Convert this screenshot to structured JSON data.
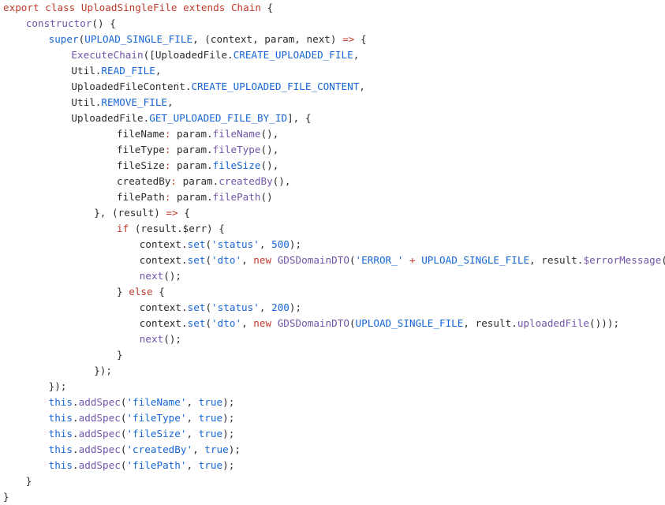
{
  "editor": {
    "language": "javascript",
    "file_title": "UploadSingleFile",
    "background_color": "#ffffff",
    "colors": {
      "keyword": "#c0392b",
      "function": "#7253a8",
      "constant": "#1565d8",
      "string": "#1565d8",
      "number": "#1565d8",
      "plain": "#2b2b2b",
      "property_colon": "#c0392b"
    }
  },
  "code": {
    "lines": [
      {
        "indent": 0,
        "tokens": [
          {
            "t": "export",
            "c": "kw"
          },
          {
            "t": " ",
            "c": "plain"
          },
          {
            "t": "class",
            "c": "kw"
          },
          {
            "t": " ",
            "c": "plain"
          },
          {
            "t": "UploadSingleFile",
            "c": "kw"
          },
          {
            "t": " ",
            "c": "plain"
          },
          {
            "t": "extends",
            "c": "kw"
          },
          {
            "t": " ",
            "c": "plain"
          },
          {
            "t": "Chain",
            "c": "kw"
          },
          {
            "t": " {",
            "c": "plain"
          }
        ]
      },
      {
        "indent": 1,
        "tokens": [
          {
            "t": "constructor",
            "c": "fn"
          },
          {
            "t": "() {",
            "c": "plain"
          }
        ]
      },
      {
        "indent": 2,
        "tokens": [
          {
            "t": "super",
            "c": "const"
          },
          {
            "t": "(",
            "c": "plain"
          },
          {
            "t": "UPLOAD_SINGLE_FILE",
            "c": "const"
          },
          {
            "t": ", (context, param, next) ",
            "c": "plain"
          },
          {
            "t": "=>",
            "c": "kw"
          },
          {
            "t": " {",
            "c": "plain"
          }
        ]
      },
      {
        "indent": 3,
        "tokens": [
          {
            "t": "ExecuteChain",
            "c": "fn"
          },
          {
            "t": "([UploadedFile.",
            "c": "plain"
          },
          {
            "t": "CREATE_UPLOADED_FILE",
            "c": "const"
          },
          {
            "t": ",",
            "c": "plain"
          }
        ]
      },
      {
        "indent": 3,
        "tokens": [
          {
            "t": "Util.",
            "c": "plain"
          },
          {
            "t": "READ_FILE",
            "c": "const"
          },
          {
            "t": ",",
            "c": "plain"
          }
        ]
      },
      {
        "indent": 3,
        "tokens": [
          {
            "t": "UploadedFileContent.",
            "c": "plain"
          },
          {
            "t": "CREATE_UPLOADED_FILE_CONTENT",
            "c": "const"
          },
          {
            "t": ",",
            "c": "plain"
          }
        ]
      },
      {
        "indent": 3,
        "tokens": [
          {
            "t": "Util.",
            "c": "plain"
          },
          {
            "t": "REMOVE_FILE",
            "c": "const"
          },
          {
            "t": ",",
            "c": "plain"
          }
        ]
      },
      {
        "indent": 3,
        "tokens": [
          {
            "t": "UploadedFile.",
            "c": "plain"
          },
          {
            "t": "GET_UPLOADED_FILE_BY_ID",
            "c": "const"
          },
          {
            "t": "], {",
            "c": "plain"
          }
        ]
      },
      {
        "indent": 5,
        "tokens": [
          {
            "t": "fileName",
            "c": "plain"
          },
          {
            "t": ":",
            "c": "colon"
          },
          {
            "t": " param.",
            "c": "plain"
          },
          {
            "t": "fileName",
            "c": "fn"
          },
          {
            "t": "(),",
            "c": "plain"
          }
        ]
      },
      {
        "indent": 5,
        "tokens": [
          {
            "t": "fileType",
            "c": "plain"
          },
          {
            "t": ":",
            "c": "colon"
          },
          {
            "t": " param.",
            "c": "plain"
          },
          {
            "t": "fileType",
            "c": "fn"
          },
          {
            "t": "(),",
            "c": "plain"
          }
        ]
      },
      {
        "indent": 5,
        "tokens": [
          {
            "t": "fileSize",
            "c": "plain"
          },
          {
            "t": ":",
            "c": "colon"
          },
          {
            "t": " param.",
            "c": "plain"
          },
          {
            "t": "fileSize",
            "c": "const"
          },
          {
            "t": "(),",
            "c": "plain"
          }
        ]
      },
      {
        "indent": 5,
        "tokens": [
          {
            "t": "createdBy",
            "c": "plain"
          },
          {
            "t": ":",
            "c": "colon"
          },
          {
            "t": " param.",
            "c": "plain"
          },
          {
            "t": "createdBy",
            "c": "fn"
          },
          {
            "t": "(),",
            "c": "plain"
          }
        ]
      },
      {
        "indent": 5,
        "tokens": [
          {
            "t": "filePath",
            "c": "plain"
          },
          {
            "t": ":",
            "c": "colon"
          },
          {
            "t": " param.",
            "c": "plain"
          },
          {
            "t": "filePath",
            "c": "fn"
          },
          {
            "t": "()",
            "c": "plain"
          }
        ]
      },
      {
        "indent": 4,
        "tokens": [
          {
            "t": "}, (result) ",
            "c": "plain"
          },
          {
            "t": "=>",
            "c": "kw"
          },
          {
            "t": " {",
            "c": "plain"
          }
        ]
      },
      {
        "indent": 5,
        "tokens": [
          {
            "t": "if",
            "c": "kw"
          },
          {
            "t": " (result.$err) {",
            "c": "plain"
          }
        ]
      },
      {
        "indent": 6,
        "tokens": [
          {
            "t": "context.",
            "c": "plain"
          },
          {
            "t": "set",
            "c": "const"
          },
          {
            "t": "(",
            "c": "plain"
          },
          {
            "t": "'status'",
            "c": "str"
          },
          {
            "t": ", ",
            "c": "plain"
          },
          {
            "t": "500",
            "c": "num"
          },
          {
            "t": ");",
            "c": "plain"
          }
        ]
      },
      {
        "indent": 6,
        "tokens": [
          {
            "t": "context.",
            "c": "plain"
          },
          {
            "t": "set",
            "c": "const"
          },
          {
            "t": "(",
            "c": "plain"
          },
          {
            "t": "'dto'",
            "c": "str"
          },
          {
            "t": ", ",
            "c": "plain"
          },
          {
            "t": "new",
            "c": "kw"
          },
          {
            "t": " ",
            "c": "plain"
          },
          {
            "t": "GDSDomainDTO",
            "c": "fn"
          },
          {
            "t": "(",
            "c": "plain"
          },
          {
            "t": "'ERROR_'",
            "c": "str"
          },
          {
            "t": " ",
            "c": "plain"
          },
          {
            "t": "+",
            "c": "kw"
          },
          {
            "t": " ",
            "c": "plain"
          },
          {
            "t": "UPLOAD_SINGLE_FILE",
            "c": "const"
          },
          {
            "t": ", result.",
            "c": "plain"
          },
          {
            "t": "$errorMessage",
            "c": "fn"
          },
          {
            "t": "()));",
            "c": "plain"
          }
        ]
      },
      {
        "indent": 6,
        "tokens": [
          {
            "t": "next",
            "c": "fn"
          },
          {
            "t": "();",
            "c": "plain"
          }
        ]
      },
      {
        "indent": 5,
        "tokens": [
          {
            "t": "} ",
            "c": "plain"
          },
          {
            "t": "else",
            "c": "kw"
          },
          {
            "t": " {",
            "c": "plain"
          }
        ]
      },
      {
        "indent": 6,
        "tokens": [
          {
            "t": "context.",
            "c": "plain"
          },
          {
            "t": "set",
            "c": "const"
          },
          {
            "t": "(",
            "c": "plain"
          },
          {
            "t": "'status'",
            "c": "str"
          },
          {
            "t": ", ",
            "c": "plain"
          },
          {
            "t": "200",
            "c": "num"
          },
          {
            "t": ");",
            "c": "plain"
          }
        ]
      },
      {
        "indent": 6,
        "tokens": [
          {
            "t": "context.",
            "c": "plain"
          },
          {
            "t": "set",
            "c": "const"
          },
          {
            "t": "(",
            "c": "plain"
          },
          {
            "t": "'dto'",
            "c": "str"
          },
          {
            "t": ", ",
            "c": "plain"
          },
          {
            "t": "new",
            "c": "kw"
          },
          {
            "t": " ",
            "c": "plain"
          },
          {
            "t": "GDSDomainDTO",
            "c": "fn"
          },
          {
            "t": "(",
            "c": "plain"
          },
          {
            "t": "UPLOAD_SINGLE_FILE",
            "c": "const"
          },
          {
            "t": ", result.",
            "c": "plain"
          },
          {
            "t": "uploadedFile",
            "c": "fn"
          },
          {
            "t": "()));",
            "c": "plain"
          }
        ]
      },
      {
        "indent": 6,
        "tokens": [
          {
            "t": "next",
            "c": "fn"
          },
          {
            "t": "();",
            "c": "plain"
          }
        ]
      },
      {
        "indent": 5,
        "tokens": [
          {
            "t": "}",
            "c": "plain"
          }
        ]
      },
      {
        "indent": 4,
        "tokens": [
          {
            "t": "});",
            "c": "plain"
          }
        ]
      },
      {
        "indent": 2,
        "tokens": [
          {
            "t": "});",
            "c": "plain"
          }
        ]
      },
      {
        "indent": 2,
        "tokens": [
          {
            "t": "this",
            "c": "const"
          },
          {
            "t": ".",
            "c": "plain"
          },
          {
            "t": "addSpec",
            "c": "fn"
          },
          {
            "t": "(",
            "c": "plain"
          },
          {
            "t": "'fileName'",
            "c": "str"
          },
          {
            "t": ", ",
            "c": "plain"
          },
          {
            "t": "true",
            "c": "const"
          },
          {
            "t": ");",
            "c": "plain"
          }
        ]
      },
      {
        "indent": 2,
        "tokens": [
          {
            "t": "this",
            "c": "const"
          },
          {
            "t": ".",
            "c": "plain"
          },
          {
            "t": "addSpec",
            "c": "fn"
          },
          {
            "t": "(",
            "c": "plain"
          },
          {
            "t": "'fileType'",
            "c": "str"
          },
          {
            "t": ", ",
            "c": "plain"
          },
          {
            "t": "true",
            "c": "const"
          },
          {
            "t": ");",
            "c": "plain"
          }
        ]
      },
      {
        "indent": 2,
        "tokens": [
          {
            "t": "this",
            "c": "const"
          },
          {
            "t": ".",
            "c": "plain"
          },
          {
            "t": "addSpec",
            "c": "fn"
          },
          {
            "t": "(",
            "c": "plain"
          },
          {
            "t": "'fileSize'",
            "c": "str"
          },
          {
            "t": ", ",
            "c": "plain"
          },
          {
            "t": "true",
            "c": "const"
          },
          {
            "t": ");",
            "c": "plain"
          }
        ]
      },
      {
        "indent": 2,
        "tokens": [
          {
            "t": "this",
            "c": "const"
          },
          {
            "t": ".",
            "c": "plain"
          },
          {
            "t": "addSpec",
            "c": "fn"
          },
          {
            "t": "(",
            "c": "plain"
          },
          {
            "t": "'createdBy'",
            "c": "str"
          },
          {
            "t": ", ",
            "c": "plain"
          },
          {
            "t": "true",
            "c": "const"
          },
          {
            "t": ");",
            "c": "plain"
          }
        ]
      },
      {
        "indent": 2,
        "tokens": [
          {
            "t": "this",
            "c": "const"
          },
          {
            "t": ".",
            "c": "plain"
          },
          {
            "t": "addSpec",
            "c": "fn"
          },
          {
            "t": "(",
            "c": "plain"
          },
          {
            "t": "'filePath'",
            "c": "str"
          },
          {
            "t": ", ",
            "c": "plain"
          },
          {
            "t": "true",
            "c": "const"
          },
          {
            "t": ");",
            "c": "plain"
          }
        ]
      },
      {
        "indent": 1,
        "tokens": [
          {
            "t": "}",
            "c": "plain"
          }
        ]
      },
      {
        "indent": 0,
        "tokens": [
          {
            "t": "}",
            "c": "plain"
          }
        ]
      }
    ]
  }
}
